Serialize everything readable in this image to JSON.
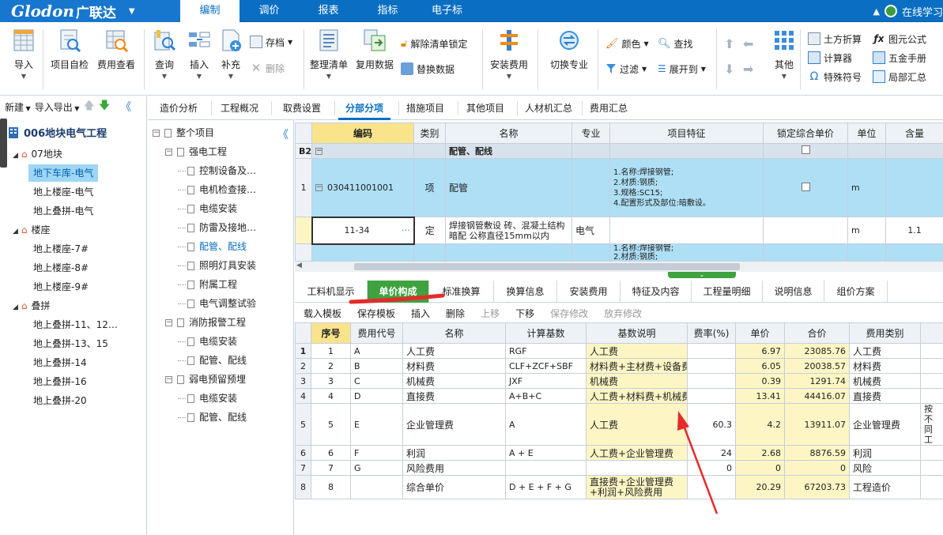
{
  "app": {
    "logo_en": "Glodon",
    "logo_cn": "广联达",
    "online": "在线学习"
  },
  "menu": {
    "tabs": [
      "编制",
      "调价",
      "报表",
      "指标",
      "电子标"
    ],
    "active": 0
  },
  "ribbon": {
    "import": "导入",
    "self_check": "项目自检",
    "fee_view": "费用查看",
    "query": "查询",
    "insert": "插入",
    "supplement": "补充",
    "save_file": "存档",
    "delete": "删除",
    "organize": "整理清单",
    "reuse": "复用数据",
    "unlock": "解除清单锁定",
    "replace": "替换数据",
    "install_fee": "安装费用",
    "switch_major": "切换专业",
    "color": "颜色",
    "find": "查找",
    "filter": "过滤",
    "expand_to": "展开到",
    "other": "其他",
    "earth_calc": "土方折算",
    "calculator": "计算器",
    "special_symbol": "特殊符号",
    "formula": "图元公式",
    "hardware": "五金手册",
    "partial_sum": "局部汇总"
  },
  "left": {
    "new": "新建",
    "import_export": "导入导出",
    "project": "006地块电气工程",
    "tree": [
      {
        "label": "07地块",
        "level": 0,
        "group": true
      },
      {
        "label": "地下车库-电气",
        "level": 1,
        "selected": true
      },
      {
        "label": "地上楼座-电气",
        "level": 1
      },
      {
        "label": "地上叠拼-电气",
        "level": 1
      },
      {
        "label": "楼座",
        "level": 0,
        "group": true
      },
      {
        "label": "地上楼座-7#",
        "level": 1
      },
      {
        "label": "地上楼座-8#",
        "level": 1
      },
      {
        "label": "地上楼座-9#",
        "level": 1
      },
      {
        "label": "叠拼",
        "level": 0,
        "group": true
      },
      {
        "label": "地上叠拼-11、12…",
        "level": 1
      },
      {
        "label": "地上叠拼-13、15",
        "level": 1
      },
      {
        "label": "地上叠拼-14",
        "level": 1
      },
      {
        "label": "地上叠拼-16",
        "level": 1
      },
      {
        "label": "地上叠拼-20",
        "level": 1
      }
    ]
  },
  "view_tabs": [
    "造价分析",
    "工程概况",
    "取费设置",
    "分部分项",
    "措施项目",
    "其他项目",
    "人材机汇总",
    "费用汇总"
  ],
  "mid_tree": [
    {
      "label": "整个项目",
      "level": 0,
      "box": "⊟"
    },
    {
      "label": "强电工程",
      "level": 1,
      "box": "⊟"
    },
    {
      "label": "控制设备及…",
      "level": 2
    },
    {
      "label": "电机检查接…",
      "level": 2
    },
    {
      "label": "电缆安装",
      "level": 2
    },
    {
      "label": "防雷及接地…",
      "level": 2
    },
    {
      "label": "配管、配线",
      "level": 2,
      "selected": true
    },
    {
      "label": "照明灯具安装",
      "level": 2
    },
    {
      "label": "附属工程",
      "level": 2
    },
    {
      "label": "电气调整试验",
      "level": 2
    },
    {
      "label": "消防报警工程",
      "level": 1,
      "box": "⊟"
    },
    {
      "label": "电缆安装",
      "level": 2
    },
    {
      "label": "配管、配线",
      "level": 2
    },
    {
      "label": "弱电预留预埋",
      "level": 1,
      "box": "⊟"
    },
    {
      "label": "电缆安装",
      "level": 2
    },
    {
      "label": "配管、配线",
      "level": 2
    }
  ],
  "upper": {
    "headers": [
      "编码",
      "类别",
      "名称",
      "专业",
      "项目特征",
      "锁定综合单价",
      "单位",
      "含量"
    ],
    "b2": {
      "rn": "B2",
      "name": "配管、配线"
    },
    "row1": {
      "rn": "1",
      "code": "030411001001",
      "cat": "项",
      "name": "配管",
      "feature": "1.名称:焊接钢管;\n2.材质:钢质;\n3.规格:SC15;\n4.配置形式及部位:暗敷设。",
      "unit": "m"
    },
    "row2": {
      "code": "11-34",
      "cat": "定",
      "name": "焊接钢管敷设 砖、混凝土结构暗配 公称直径15mm以内",
      "major": "电气",
      "unit": "m",
      "qty": "1.1",
      "more": "···"
    },
    "row3": {
      "feature": "1.名称:焊接钢管;\n2.材质:钢质;"
    }
  },
  "bottom_tabs": [
    "工料机显示",
    "单价构成",
    "标准换算",
    "换算信息",
    "安装费用",
    "特征及内容",
    "工程量明细",
    "说明信息",
    "组价方案"
  ],
  "bottom_tools": [
    {
      "label": "载入模板",
      "dis": false
    },
    {
      "label": "保存模板",
      "dis": false
    },
    {
      "label": "插入",
      "dis": false
    },
    {
      "label": "删除",
      "dis": false
    },
    {
      "label": "上移",
      "dis": true
    },
    {
      "label": "下移",
      "dis": false
    },
    {
      "label": "保存修改",
      "dis": true
    },
    {
      "label": "放弃修改",
      "dis": true
    }
  ],
  "lower": {
    "headers": [
      "序号",
      "费用代号",
      "名称",
      "计算基数",
      "基数说明",
      "费率(%)",
      "单价",
      "合价",
      "费用类别"
    ],
    "rows": [
      {
        "rn": "1",
        "no": "1",
        "code": "A",
        "name": "人工费",
        "base": "RGF",
        "desc": "人工费",
        "rate": "",
        "price": "6.97",
        "total": "23085.76",
        "type": "人工费"
      },
      {
        "rn": "2",
        "no": "2",
        "code": "B",
        "name": "材料费",
        "base": "CLF+ZCF+SBF",
        "desc": "材料费+主材费+设备费",
        "rate": "",
        "price": "6.05",
        "total": "20038.57",
        "type": "材料费"
      },
      {
        "rn": "3",
        "no": "3",
        "code": "C",
        "name": "机械费",
        "base": "JXF",
        "desc": "机械费",
        "rate": "",
        "price": "0.39",
        "total": "1291.74",
        "type": "机械费"
      },
      {
        "rn": "4",
        "no": "4",
        "code": "D",
        "name": "直接费",
        "base": "A+B+C",
        "desc": "人工费+材料费+机械费",
        "rate": "",
        "price": "13.41",
        "total": "44416.07",
        "type": "直接费"
      },
      {
        "rn": "5",
        "no": "5",
        "code": "E",
        "name": "企业管理费",
        "base": "A",
        "desc": "人工费",
        "rate": "60.3",
        "price": "4.2",
        "total": "13911.07",
        "type": "企业管理费",
        "extra": "按不同工"
      },
      {
        "rn": "6",
        "no": "6",
        "code": "F",
        "name": "利润",
        "base": "A + E",
        "desc": "人工费+企业管理费",
        "rate": "24",
        "price": "2.68",
        "total": "8876.59",
        "type": "利润"
      },
      {
        "rn": "7",
        "no": "7",
        "code": "G",
        "name": "风险费用",
        "base": "",
        "desc": "",
        "rate": "0",
        "price": "0",
        "total": "0",
        "type": "风险"
      },
      {
        "rn": "8",
        "no": "8",
        "code": "",
        "name": "综合单价",
        "base": "D + E + F + G",
        "desc": "直接费+企业管理费+利润+风险费用",
        "rate": "",
        "price": "20.29",
        "total": "67203.73",
        "type": "工程造价"
      }
    ]
  }
}
